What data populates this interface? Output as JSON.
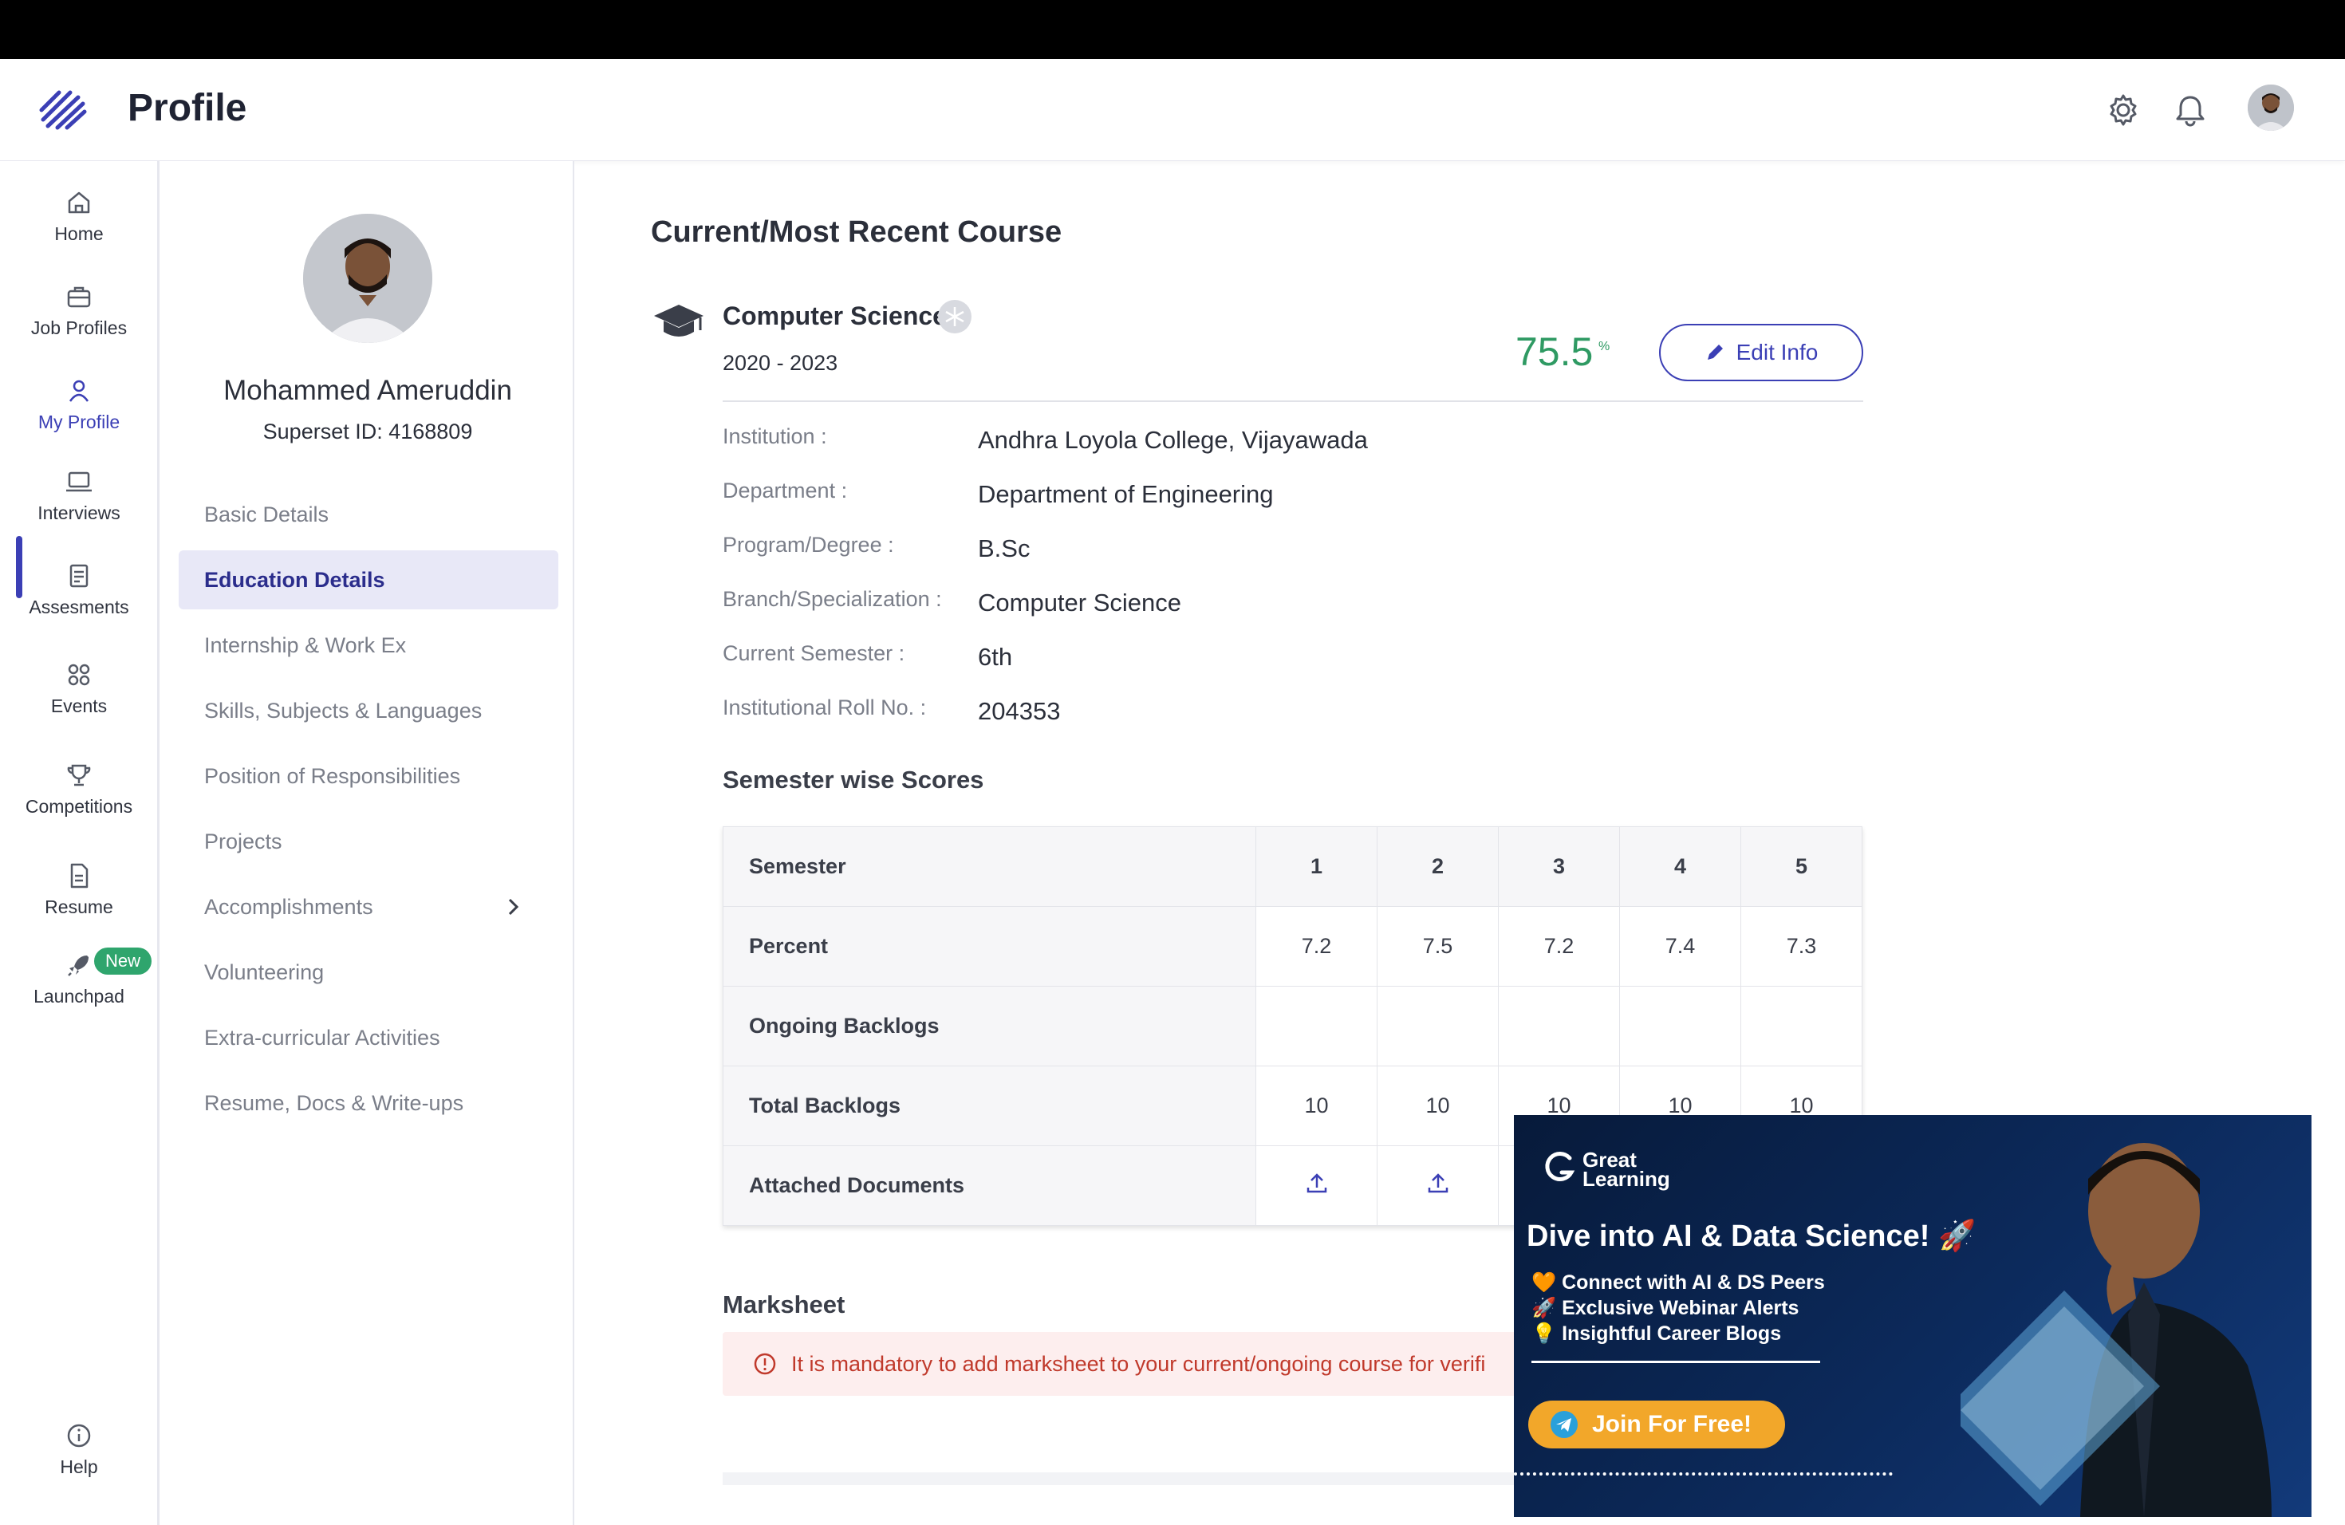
{
  "header": {
    "title": "Profile"
  },
  "nav": {
    "items": [
      {
        "label": "Home",
        "icon": "home-icon"
      },
      {
        "label": "Job Profiles",
        "icon": "briefcase-icon"
      },
      {
        "label": "My Profile",
        "icon": "user-icon"
      },
      {
        "label": "Interviews",
        "icon": "laptop-icon"
      },
      {
        "label": "Assesments",
        "icon": "clipboard-icon"
      },
      {
        "label": "Events",
        "icon": "grid-icon"
      },
      {
        "label": "Competitions",
        "icon": "trophy-icon"
      },
      {
        "label": "Resume",
        "icon": "document-icon"
      },
      {
        "label": "Launchpad",
        "icon": "rocket-icon"
      }
    ],
    "new_badge": "New",
    "help": "Help"
  },
  "profile": {
    "name": "Mohammed Ameruddin",
    "superset_id": "Superset ID: 4168809",
    "menu": [
      "Basic Details",
      "Education Details",
      "Internship & Work Ex",
      "Skills, Subjects & Languages",
      "Position of Responsibilities",
      "Projects",
      "Accomplishments",
      "Volunteering",
      "Extra-curricular Activities",
      "Resume, Docs & Write-ups"
    ]
  },
  "course": {
    "section_title": "Current/Most Recent Course",
    "name": "Computer Science",
    "years": "2020 - 2023",
    "percent": "75.5",
    "percent_sign": "%",
    "edit_label": "Edit Info",
    "details": [
      {
        "label": "Institution :",
        "value": "Andhra Loyola College, Vijayawada"
      },
      {
        "label": "Department :",
        "value": "Department of Engineering"
      },
      {
        "label": "Program/Degree :",
        "value": "B.Sc"
      },
      {
        "label": "Branch/Specialization :",
        "value": "Computer Science"
      },
      {
        "label": "Current Semester :",
        "value": "6th"
      },
      {
        "label": "Institutional Roll No. :",
        "value": "204353"
      }
    ]
  },
  "semester_scores": {
    "title": "Semester wise Scores",
    "header": [
      "Semester",
      "1",
      "2",
      "3",
      "4",
      "5"
    ],
    "rows": [
      {
        "label": "Percent",
        "values": [
          "7.2",
          "7.5",
          "7.2",
          "7.4",
          "7.3"
        ]
      },
      {
        "label": "Ongoing Backlogs",
        "values": [
          "",
          "",
          "",
          "",
          ""
        ]
      },
      {
        "label": "Total Backlogs",
        "values": [
          "10",
          "10",
          "10",
          "10",
          "10"
        ]
      },
      {
        "label": "Attached Documents",
        "values": [
          "upload-icon",
          "upload-icon",
          "upload-icon",
          "upload-icon",
          "upload-icon"
        ]
      }
    ]
  },
  "marksheet": {
    "title": "Marksheet",
    "alert": "It is mandatory to add marksheet to your current/ongoing course for verifi"
  },
  "ad": {
    "brand_line1": "Great",
    "brand_line2": "Learning",
    "headline": "Dive into AI & Data Science! 🚀",
    "bullets": [
      "🧡 Connect with AI & DS Peers",
      "🚀 Exclusive Webinar Alerts",
      "💡 Insightful Career Blogs"
    ],
    "cta": "Join For Free!"
  },
  "colors": {
    "accent": "#3b3fb5",
    "percent_green": "#2f9a63",
    "alert_bg": "#fdeeee",
    "alert_text": "#c0392b",
    "ad_bg": "#0c2a5c",
    "ad_button": "#f2a72a"
  }
}
